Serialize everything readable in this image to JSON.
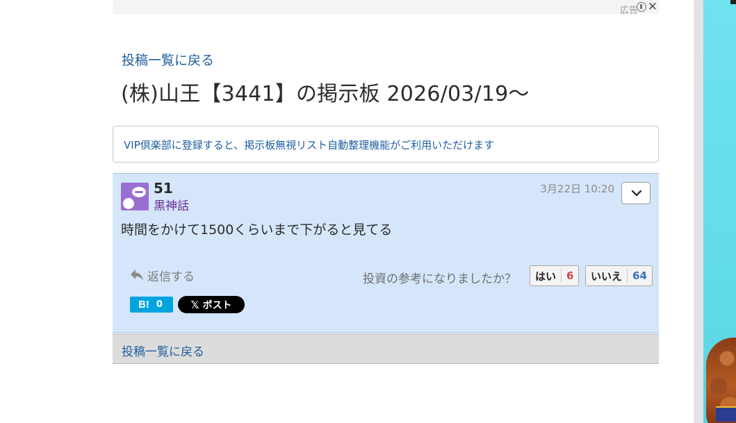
{
  "ad": {
    "label": "広告",
    "close_glyph": "✕",
    "info_icon": "info-icon"
  },
  "nav": {
    "back_to_list": "投稿一覧に戻る"
  },
  "board": {
    "title": "(株)山王【3441】の掲示板 2026/03/19〜"
  },
  "vip_notice": {
    "text": "VIP倶楽部に登録すると、掲示板無視リスト自動整理機能がご利用いただけます"
  },
  "comment": {
    "number": "51",
    "author": "黒神話",
    "timestamp": "3月22日 10:20",
    "body": "時間をかけて1500くらいまで下がると見てる",
    "reply_label": "返信する",
    "vote_question": "投資の参考になりましたか？",
    "vote_yes_label": "はい",
    "vote_yes_count": "6",
    "vote_no_label": "いいえ",
    "vote_no_count": "64",
    "hatena_label": "B!",
    "hatena_count": "0",
    "x_logo": "𝕏",
    "x_post_label": "ポスト"
  },
  "footer": {
    "back_to_list": "投稿一覧に戻る"
  },
  "colors": {
    "link": "#1f5e9f",
    "comment_bg": "#d5e6fa",
    "author": "#6a2c91",
    "yes_count": "#d84242",
    "no_count": "#3b6fc6",
    "hatena": "#00a4de"
  }
}
